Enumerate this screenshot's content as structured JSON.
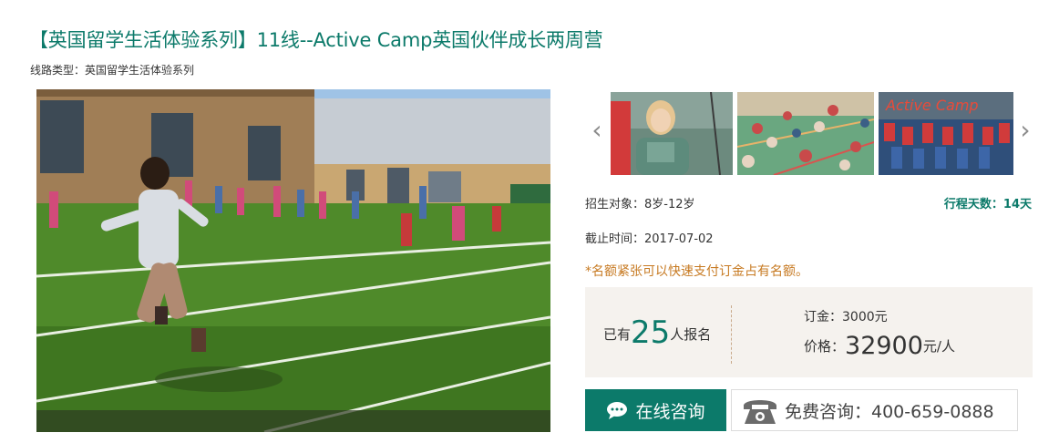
{
  "header": {
    "title": "【英国留学生活体验系列】11线--Active Camp英国伙伴成长两周营",
    "route_type": "线路类型：英国留学生活体验系列"
  },
  "gallery": {
    "main_image": "kids-running-on-grass-field",
    "thumbnails": [
      "girl-at-camp",
      "kids-sitting-in-gym",
      "active-camp-group-photo"
    ],
    "thumb3_caption": "Active Camp",
    "prev_icon": "chevron-left-icon",
    "next_icon": "chevron-right-icon"
  },
  "details": {
    "target": "招生对象：8岁-12岁",
    "days": "行程天数：14天",
    "deadline": "截止时间：2017-07-02",
    "notice": "*名额紧张可以快速支付订金占有名额。"
  },
  "booking": {
    "count_prefix": "已有",
    "count": "25",
    "count_suffix": "人报名",
    "deposit": "订金：3000元",
    "price_label": "价格：",
    "price": "32900",
    "price_unit": "元/人"
  },
  "actions": {
    "consult_label": "在线咨询",
    "phone_label": "免费咨询：400-659-0888"
  },
  "colors": {
    "accent": "#0c7a6a",
    "notice": "#c77a22",
    "panel_bg": "#f5f2ee"
  }
}
